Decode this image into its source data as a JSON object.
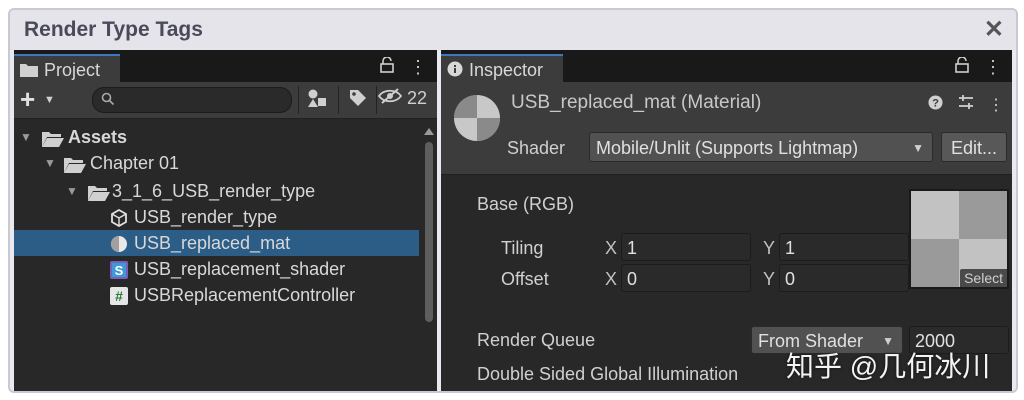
{
  "window": {
    "title": "Render Type Tags",
    "close_glyph": "✕"
  },
  "project": {
    "tab_label": "Project",
    "hidden_count": "22",
    "search": {
      "value": "",
      "placeholder": ""
    },
    "tree": [
      {
        "label": "Assets",
        "icon": "folder-open-icon",
        "bold": true
      },
      {
        "label": "Chapter 01",
        "icon": "folder-open-icon"
      },
      {
        "label": "3_1_6_USB_render_type",
        "icon": "folder-open-icon"
      },
      {
        "label": "USB_render_type",
        "icon": "unity-scene-icon"
      },
      {
        "label": "USB_replaced_mat",
        "icon": "material-icon",
        "selected": true
      },
      {
        "label": "USB_replacement_shader",
        "icon": "shader-icon"
      },
      {
        "label": "USBReplacementController",
        "icon": "csharp-script-icon"
      }
    ]
  },
  "inspector": {
    "tab_label": "Inspector",
    "material_name": "USB_replaced_mat (Material)",
    "shader_label": "Shader",
    "shader_value": "Mobile/Unlit (Supports Lightmap)",
    "edit_label": "Edit...",
    "base_label": "Base (RGB)",
    "tiling_label": "Tiling",
    "offset_label": "Offset",
    "x_label": "X",
    "y_label": "Y",
    "tiling": {
      "x": "1",
      "y": "1"
    },
    "offset": {
      "x": "0",
      "y": "0"
    },
    "texture_select_label": "Select",
    "render_queue_label": "Render Queue",
    "render_queue_mode": "From Shader",
    "render_queue_value": "2000",
    "dsgi_label": "Double Sided Global Illumination"
  },
  "watermark": "知乎 @几何冰川",
  "colors": {
    "selection": "#2c5d87",
    "panel_bg": "#282828",
    "header_bg": "#3c3c3c",
    "tab_accent": "#3a79bb"
  }
}
